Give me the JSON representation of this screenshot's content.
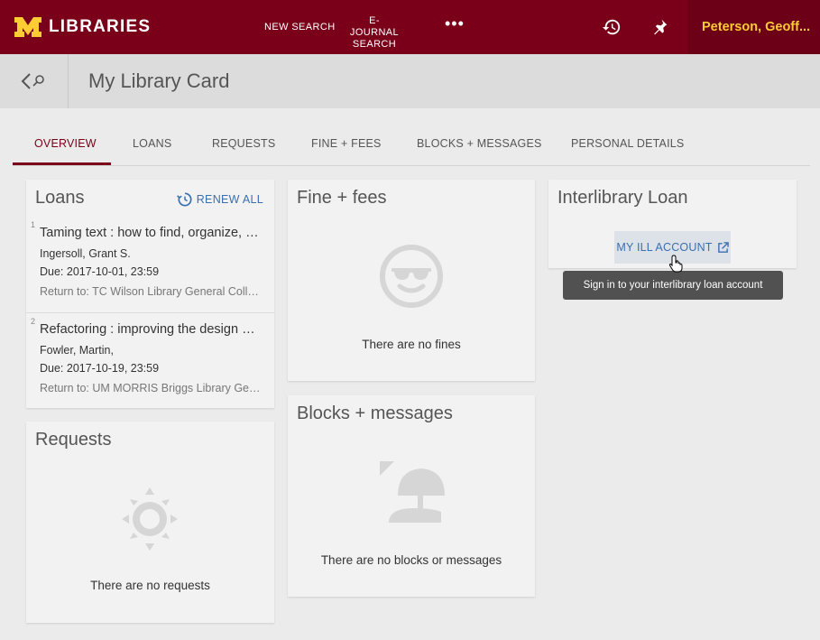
{
  "header": {
    "logo_text": "LIBRARIES",
    "nav": {
      "new_search": "NEW SEARCH",
      "ejournal_line1": "E-JOURNAL",
      "ejournal_line2": "SEARCH",
      "more": "•••"
    },
    "icons": [
      "history-icon",
      "pin-icon"
    ],
    "user_name": "Peterson, Geoff..."
  },
  "subheader": {
    "title": "My Library Card"
  },
  "tabs": [
    {
      "label": "OVERVIEW",
      "active": true
    },
    {
      "label": "LOANS"
    },
    {
      "label": "REQUESTS"
    },
    {
      "label": "FINE + FEES"
    },
    {
      "label": "BLOCKS + MESSAGES"
    },
    {
      "label": "PERSONAL DETAILS"
    }
  ],
  "loans": {
    "title": "Loans",
    "renew_all": "RENEW ALL",
    "items": [
      {
        "number": "1",
        "title": "Taming text : how to find, organize, and manipulate it",
        "author": "Ingersoll, Grant S.",
        "due": "Due: 2017-10-01, 23:59",
        "return_to": "Return to: TC Wilson Library General Collection"
      },
      {
        "number": "2",
        "title": "Refactoring : improving the design of existing code",
        "author": "Fowler, Martin,",
        "due": "Due: 2017-10-19, 23:59",
        "return_to": "Return to: UM MORRIS Briggs Library General Collection"
      }
    ]
  },
  "requests": {
    "title": "Requests",
    "empty": "There are no requests"
  },
  "fines": {
    "title": "Fine + fees",
    "empty": "There are no fines"
  },
  "blocks": {
    "title": "Blocks + messages",
    "empty": "There are no blocks or messages"
  },
  "ill": {
    "title": "Interlibrary Loan",
    "button": "MY ILL ACCOUNT",
    "tooltip": "Sign in to your interlibrary loan account"
  },
  "colors": {
    "brand": "#7a0019",
    "accent_gold": "#ffcc33",
    "link": "#3a6fb0"
  }
}
